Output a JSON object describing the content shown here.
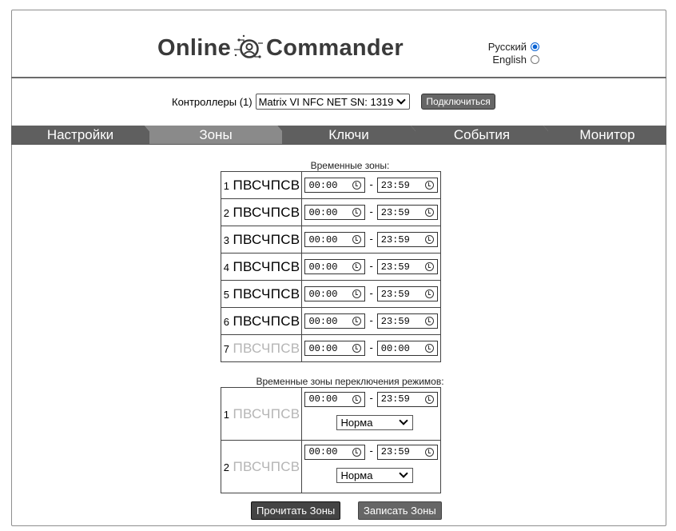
{
  "header": {
    "logo": {
      "left": "Online",
      "right": "Commander"
    },
    "languages": [
      {
        "label": "Русский",
        "selected": true
      },
      {
        "label": "English",
        "selected": false
      }
    ]
  },
  "controller_bar": {
    "label": "Контроллеры (1)",
    "selected": "Matrix VI NFC NET SN: 1319",
    "connect_label": "Подключиться"
  },
  "tabs": [
    {
      "label": "Настройки",
      "active": false
    },
    {
      "label": "Зоны",
      "active": true
    },
    {
      "label": "Ключи",
      "active": false
    },
    {
      "label": "События",
      "active": false
    },
    {
      "label": "Монитор",
      "active": false
    }
  ],
  "time_zones": {
    "title": "Временные зоны:",
    "rows": [
      {
        "index": "1",
        "days": "ПВСЧПСВ",
        "active": true,
        "from": "00:00",
        "to": "23:59"
      },
      {
        "index": "2",
        "days": "ПВСЧПСВ",
        "active": true,
        "from": "00:00",
        "to": "23:59"
      },
      {
        "index": "3",
        "days": "ПВСЧПСВ",
        "active": true,
        "from": "00:00",
        "to": "23:59"
      },
      {
        "index": "4",
        "days": "ПВСЧПСВ",
        "active": true,
        "from": "00:00",
        "to": "23:59"
      },
      {
        "index": "5",
        "days": "ПВСЧПСВ",
        "active": true,
        "from": "00:00",
        "to": "23:59"
      },
      {
        "index": "6",
        "days": "ПВСЧПСВ",
        "active": true,
        "from": "00:00",
        "to": "23:59"
      },
      {
        "index": "7",
        "days": "ПВСЧПСВ",
        "active": false,
        "from": "00:00",
        "to": "00:00"
      }
    ]
  },
  "mode_zones": {
    "title": "Временные зоны переключения режимов:",
    "rows": [
      {
        "index": "1",
        "days": "ПВСЧПСВ",
        "active": false,
        "from": "00:00",
        "to": "23:59",
        "mode": "Норма"
      },
      {
        "index": "2",
        "days": "ПВСЧПСВ",
        "active": false,
        "from": "00:00",
        "to": "23:59",
        "mode": "Норма"
      }
    ]
  },
  "actions": {
    "read_label": "Прочитать Зоны",
    "write_label": "Записать Зоны"
  },
  "colors": {
    "tab_bg": "#5f5f5f",
    "tab_active_bg": "#8a8a8a",
    "radio_accent": "#0a63d4",
    "button_bg": "#5e5e5e"
  }
}
